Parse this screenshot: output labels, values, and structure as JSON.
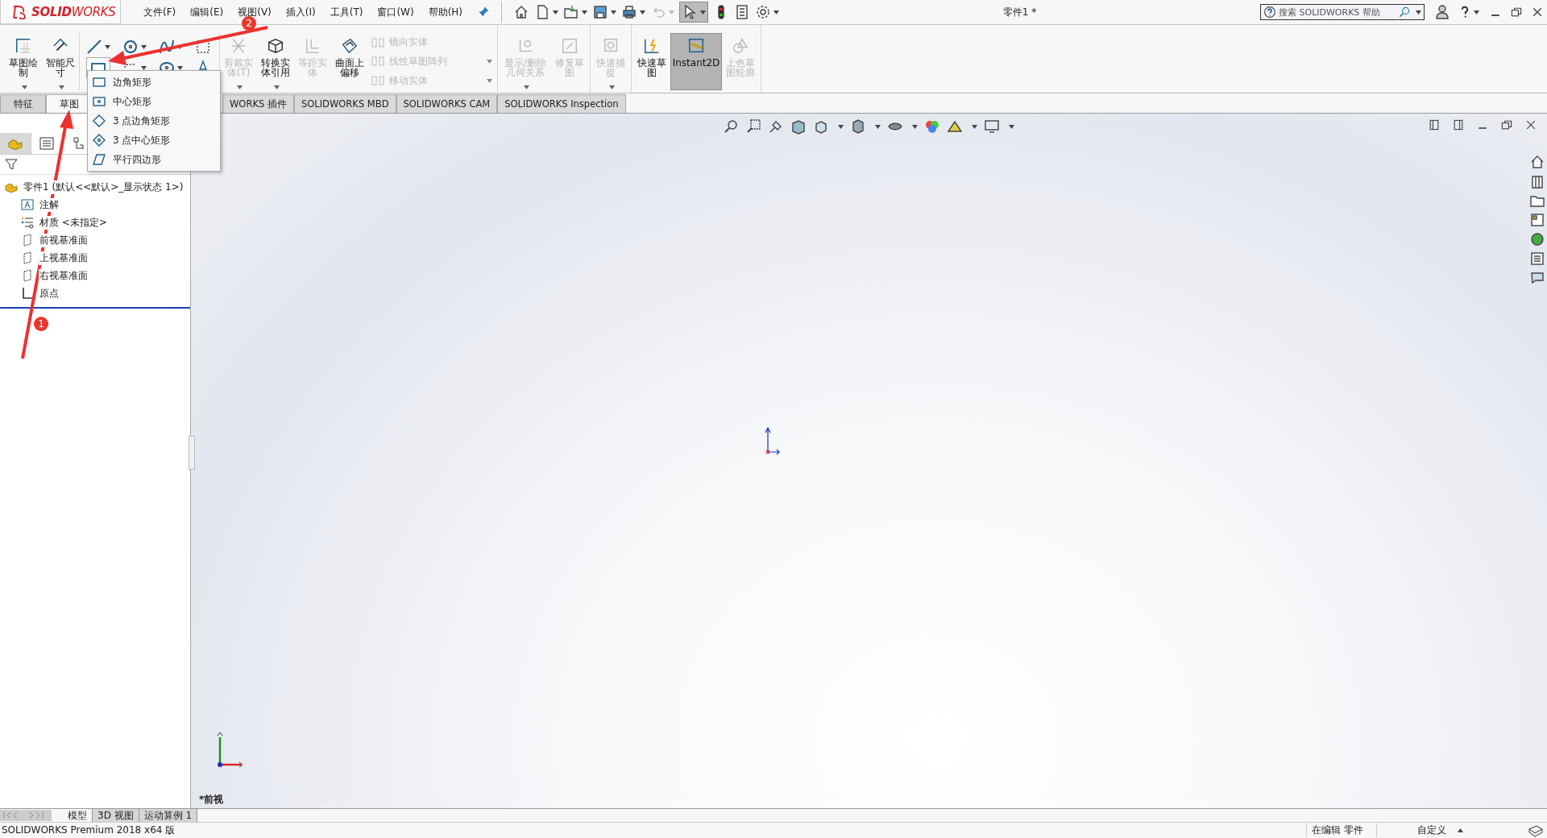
{
  "logo": {
    "text": "**SOLID**WORKS"
  },
  "menu": [
    {
      "label": "文件(F)"
    },
    {
      "label": "编辑(E)"
    },
    {
      "label": "视图(V)"
    },
    {
      "label": "插入(I)"
    },
    {
      "label": "工具(T)"
    },
    {
      "label": "窗口(W)"
    },
    {
      "label": "帮助(H)"
    }
  ],
  "document_title": "零件1 *",
  "help_search": {
    "placeholder": "搜索 SOLIDWORKS 帮助"
  },
  "ribbon_groups": [
    [
      {
        "kind": "large",
        "label": "草图绘制",
        "disabled": false,
        "selected": false,
        "has_menu": true
      },
      {
        "kind": "large",
        "label": "智能尺寸",
        "disabled": false,
        "selected": false,
        "has_menu": true
      },
      {
        "kind": "tools"
      },
      {
        "kind": "large",
        "label": "剪裁实体(T)",
        "disabled": true,
        "selected": false,
        "has_menu": true
      },
      {
        "kind": "large",
        "label": "转换实体引用",
        "disabled": false,
        "selected": false,
        "has_menu": true
      },
      {
        "kind": "large",
        "label": "等距实体",
        "disabled": true,
        "selected": false,
        "has_menu": false
      },
      {
        "kind": "large",
        "label": "曲面上偏移",
        "disabled": false,
        "selected": false,
        "has_menu": false
      },
      {
        "kind": "stack",
        "items": [
          {
            "label": "镜向实体",
            "disabled": true,
            "has_menu": false
          },
          {
            "label": "线性草图阵列",
            "disabled": true,
            "has_menu": true
          },
          {
            "label": "移动实体",
            "disabled": true,
            "has_menu": true
          }
        ]
      }
    ],
    [
      {
        "kind": "large",
        "label": "显示/删除几何关系",
        "disabled": true,
        "selected": false,
        "has_menu": true
      },
      {
        "kind": "large",
        "label": "修复草图",
        "disabled": true,
        "selected": false,
        "has_menu": false
      }
    ],
    [
      {
        "kind": "large",
        "label": "快速捕捉",
        "disabled": true,
        "selected": false,
        "has_menu": true
      }
    ],
    [
      {
        "kind": "large",
        "label": "快速草图",
        "disabled": false,
        "selected": false,
        "has_menu": false
      },
      {
        "kind": "large",
        "label": "Instant2D",
        "disabled": false,
        "selected": true,
        "has_menu": false
      },
      {
        "kind": "large",
        "label": "上色草图轮廓",
        "disabled": true,
        "selected": false,
        "has_menu": false
      }
    ]
  ],
  "rectangle_menu": [
    {
      "label": "边角矩形"
    },
    {
      "label": "中心矩形"
    },
    {
      "label": "3 点边角矩形"
    },
    {
      "label": "3 点中心矩形"
    },
    {
      "label": "平行四边形"
    }
  ],
  "left_tabs": [
    {
      "label": "特征",
      "selected": false
    },
    {
      "label": "草图",
      "selected": true
    }
  ],
  "command_tabs": [
    {
      "label": "WORKS 插件"
    },
    {
      "label": "SOLIDWORKS MBD"
    },
    {
      "label": "SOLIDWORKS CAM"
    },
    {
      "label": "SOLIDWORKS Inspection"
    }
  ],
  "manager_tabs": [
    {
      "selected": true
    },
    {
      "selected": false
    },
    {
      "selected": false
    }
  ],
  "tree": {
    "label": "零件1  (默认<<默认>_显示状态 1>)",
    "children": [
      {
        "kind": "annotation",
        "label": "注解"
      },
      {
        "kind": "material",
        "label": "材质 <未指定>"
      },
      {
        "kind": "plane",
        "label": "前视基准面"
      },
      {
        "kind": "plane",
        "label": "上视基准面"
      },
      {
        "kind": "plane",
        "label": "右视基准面"
      },
      {
        "kind": "origin",
        "label": "原点"
      }
    ]
  },
  "view_label": "*前视",
  "bottom_tabs": [
    {
      "label": "模型",
      "selected": true
    },
    {
      "label": "3D 视图",
      "selected": false
    },
    {
      "label": "运动算例 1",
      "selected": false
    }
  ],
  "status_bar": {
    "product": "SOLIDWORKS Premium 2018 x64 版",
    "mode": "在编辑 零件",
    "units": "自定义"
  },
  "callouts": [
    {
      "number": "1"
    },
    {
      "number": "2"
    }
  ]
}
